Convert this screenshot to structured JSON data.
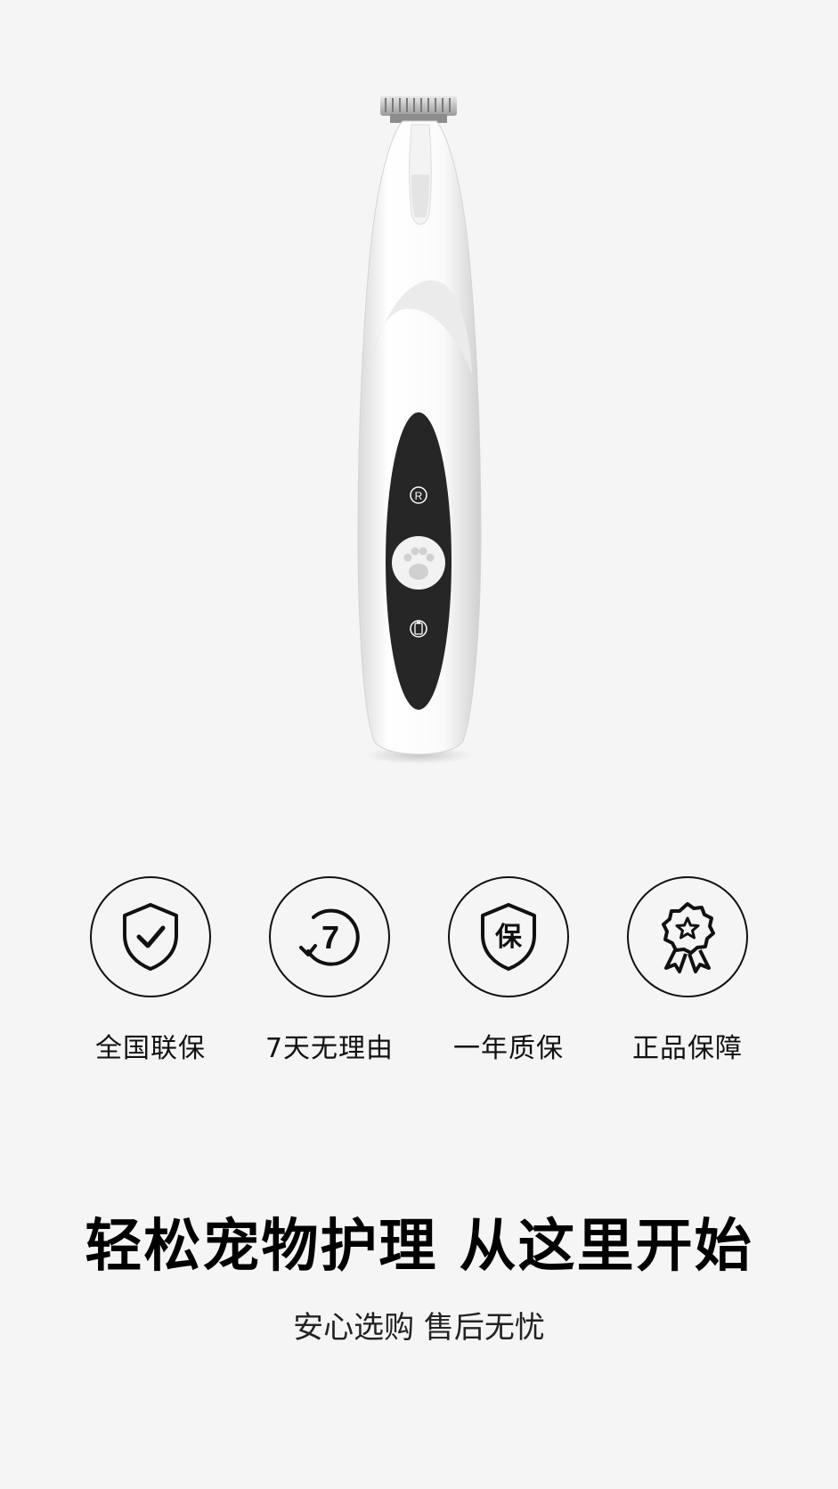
{
  "product": {
    "button_top_letter": "R",
    "icon": "pet-nail-grinder",
    "button_icon": "paw-icon",
    "battery_icon": "battery-icon"
  },
  "features": [
    {
      "label": "全国联保",
      "icon": "shield-check-icon"
    },
    {
      "label": "7天无理由",
      "icon": "seven-day-return-icon",
      "badge": "7"
    },
    {
      "label": "一年质保",
      "icon": "shield-bao-icon",
      "badge": "保"
    },
    {
      "label": "正品保障",
      "icon": "award-star-icon"
    }
  ],
  "headline": "轻松宠物护理 从这里开始",
  "subline": "安心选购 售后无忧",
  "colors": {
    "background": "#f5f5f5",
    "panel": "#2a2a2a",
    "text": "#111111"
  }
}
